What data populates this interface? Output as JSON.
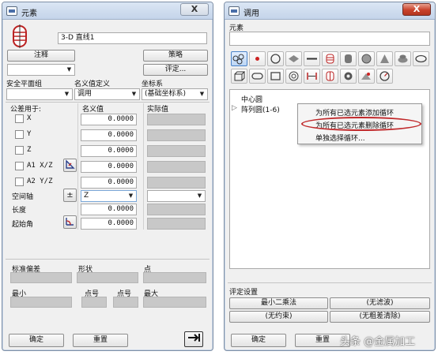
{
  "left_window": {
    "title": "元素",
    "element_name": "3-D 直线1",
    "annotation_button": "注释",
    "strategy_button": "策略",
    "evaluation_button": "评定...",
    "safety_plane_label": "安全平面组",
    "nominal_def_label": "名义值定义",
    "coord_system_label": "坐标系",
    "nominal_def_value": "调用",
    "coord_system_value": "(基础坐标系)",
    "tolerance_for_label": "公差用于:",
    "nominal_label": "名义值",
    "actual_label": "实际值",
    "rows": [
      {
        "label": "X",
        "value": "0.0000"
      },
      {
        "label": "Y",
        "value": "0.0000"
      },
      {
        "label": "Z",
        "value": "0.0000"
      },
      {
        "label": "A1 X/Z",
        "value": "0.0000"
      },
      {
        "label": "A2 Y/Z",
        "value": "0.0000"
      }
    ],
    "space_axis_label": "空间轴",
    "space_axis_sign": "±",
    "space_axis_value": "Z",
    "length_label": "长度",
    "length_value": "0.0000",
    "start_angle_label": "起始角",
    "start_angle_value": "0.0000",
    "std_dev_label": "标准偏差",
    "form_label": "形状",
    "point_label": "点",
    "min_label": "最小",
    "pt_no_label_1": "点号",
    "pt_no_label_2": "点号",
    "max_label": "最大",
    "ok_button": "确定",
    "reset_button": "重置",
    "close_glyph": "X"
  },
  "right_window": {
    "title": "调用",
    "elements_label": "元素",
    "tree_items": [
      "中心圆",
      "阵列圆(1-6)"
    ],
    "context_menu": [
      "为所有已选元素添加循环",
      "为所有已选元素删除循环",
      "单独选择循环..."
    ],
    "eval_settings_label": "评定设置",
    "least_squares_button": "最小二乘法",
    "no_filter_button": "(无滤波)",
    "no_constraint_button": "(无约束)",
    "no_outlier_button": "(无粗差清除)",
    "ok_button": "确定",
    "reset_button": "重置",
    "close_glyph": "X",
    "highlight_color": "#c0282a"
  },
  "watermark": "头条 @金属加工"
}
